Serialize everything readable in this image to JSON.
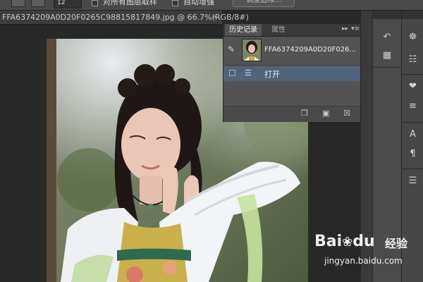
{
  "options_bar": {
    "brush_size": "12",
    "sample_all_layers_label": "对所有图层取样",
    "auto_enhance_label": "自动增强",
    "refine_edge_label": "调整边缘..."
  },
  "document": {
    "tab_title": "FFA6374209A0D20F0265C98815817849.jpg @ 66.7%(RGB/8#)",
    "close_glyph": "×"
  },
  "history_panel": {
    "tabs": [
      "历史记录",
      "属性"
    ],
    "snapshot_label": "FFA6374209A0D20F026...",
    "state_label": "打开",
    "expand_glyph": "▸▸",
    "menu_glyph": "▾≡"
  },
  "watermark": {
    "logo": "Bai",
    "logo_tail": "du",
    "cn": "经验",
    "url": "jingyan.baidu.com"
  },
  "icons": {
    "brush": "brush-icon",
    "document": "document-icon",
    "new_snapshot": "new-document-icon",
    "camera": "camera-icon",
    "trash": "trash-icon"
  },
  "colors": {
    "panel_bg": "#535353",
    "selected_row": "#50647c",
    "app_bg": "#282828"
  }
}
